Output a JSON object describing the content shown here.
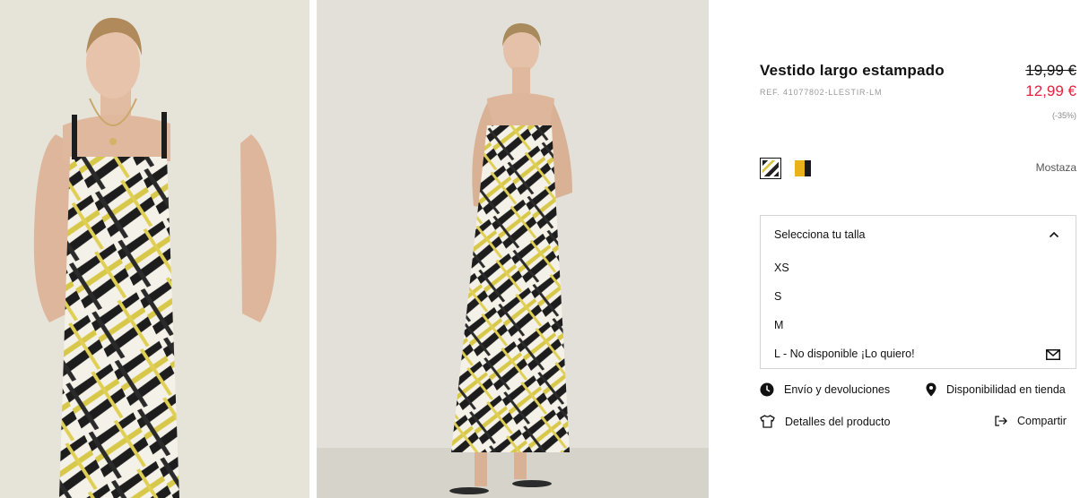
{
  "product": {
    "title": "Vestido largo estampado",
    "ref": "REF. 41077802-LLESTIR-LM",
    "price_old": "19,99 €",
    "price_new": "12,99 €",
    "discount": "(-35%)",
    "accent_color": "#e5213c"
  },
  "colors": {
    "selected_name": "Mostaza",
    "swatches": [
      "print-swatch",
      "mustard-swatch"
    ]
  },
  "size_selector": {
    "header": "Selecciona tu talla",
    "options": [
      "XS",
      "S",
      "M",
      "L - No disponible ¡Lo quiero!"
    ]
  },
  "actions": {
    "shipping": "Envío y devoluciones",
    "store_availability": "Disponibilidad en tienda",
    "details": "Detalles del producto",
    "share": "Compartir"
  },
  "icons": {
    "shipping": "clock-icon",
    "store": "location-pin-icon",
    "details": "tshirt-icon",
    "share": "share-icon",
    "chevron": "chevron-up-icon",
    "notify": "mail-icon"
  }
}
